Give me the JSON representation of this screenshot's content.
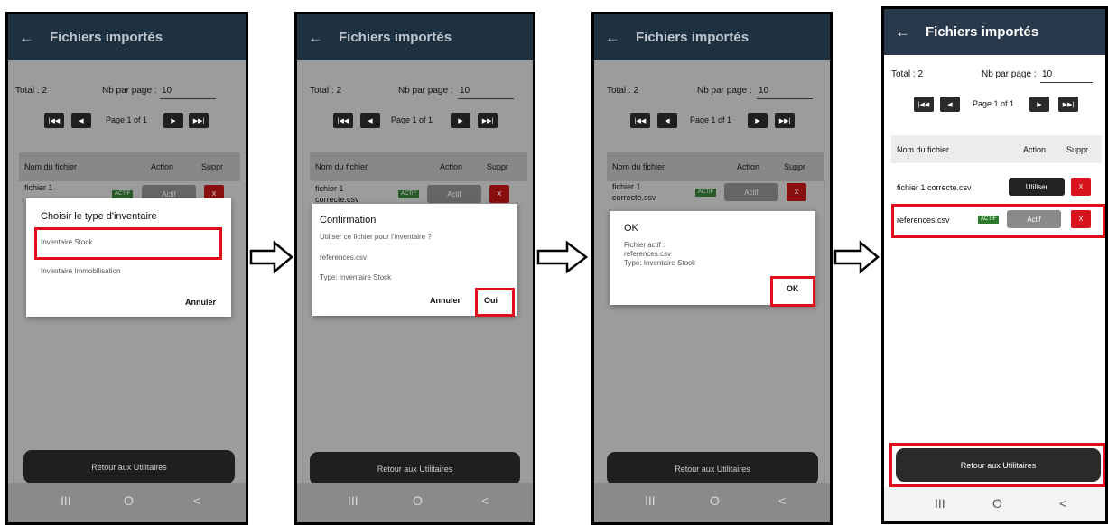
{
  "app": {
    "title": "Fichiers importés",
    "back_icon": "arrow-left-icon",
    "total_label": "Total : 2",
    "per_page_label": "Nb par page :",
    "per_page_value": "10",
    "page_indicator": "Page 1 of 1",
    "pager_icons": [
      "first-page-icon",
      "previous-page-icon",
      "next-page-icon",
      "last-page-icon"
    ],
    "col_filename": "Nom du fichier",
    "col_action": "Action",
    "col_delete": "Suppr",
    "badge_actif": "ACTIF",
    "btn_actif": "Actif",
    "btn_utiliser": "Utiliser",
    "btn_delete": "X",
    "bottom_button": "Retour aux Utilitaires",
    "nav": {
      "recents": "III",
      "home": "O",
      "back": "<"
    }
  },
  "phone1": {
    "row1_name": "fichier 1",
    "dialog": {
      "title": "Choisir le type d'inventaire",
      "option1": "Inventaire Stock",
      "option2": "Inventaire Immobilisation",
      "cancel": "Annuler"
    }
  },
  "phone2": {
    "row1_name": "fichier 1\ncorrecte.csv",
    "dialog": {
      "title": "Confirmation",
      "message": "Utiliser ce fichier pour l'inventaire ?",
      "file": "references.csv",
      "type": "Type: Inventaire Stock",
      "cancel": "Annuler",
      "ok": "Oui"
    }
  },
  "phone3": {
    "row1_name": "fichier 1\ncorrecte.csv",
    "dialog": {
      "title": "OK",
      "line1": "Fichier actif :",
      "line2": "references.csv",
      "line3": "Type: Inventaire Stock",
      "ok": "OK"
    }
  },
  "phone4": {
    "row1_name": "fichier 1 correcte.csv",
    "row2_name": "references.csv"
  },
  "colors": {
    "appbar": "#27394b",
    "highlight": "#e00d1b",
    "delete": "#d6141c",
    "badge": "#2d7a2d"
  }
}
